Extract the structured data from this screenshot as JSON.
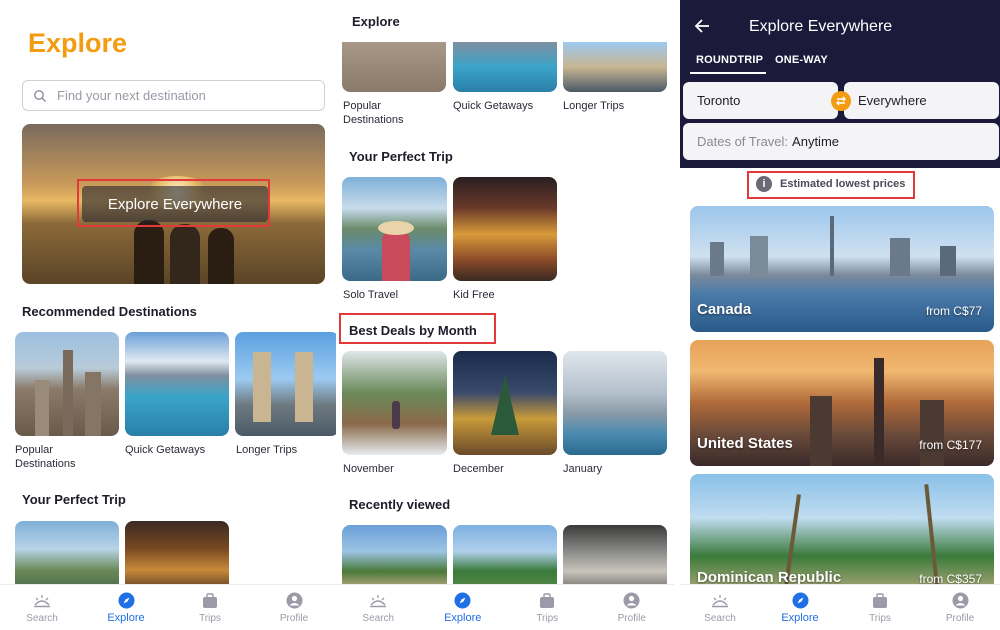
{
  "explore": {
    "title": "Explore",
    "search_placeholder": "Find your next destination",
    "hero_label": "Explore Everywhere",
    "recommended_title": "Recommended Destinations",
    "recommended": [
      {
        "label": "Popular\nDestinations"
      },
      {
        "label": "Quick Getaways"
      },
      {
        "label": "Longer Trips"
      }
    ],
    "perfect_trip_title": "Your Perfect Trip"
  },
  "explore_scrolled": {
    "header": "Explore",
    "top_row": [
      {
        "label": "Popular\nDestinations"
      },
      {
        "label": "Quick Getaways"
      },
      {
        "label": "Longer Trips"
      }
    ],
    "perfect_trip_title": "Your Perfect Trip",
    "perfect_trip": [
      {
        "label": "Solo Travel"
      },
      {
        "label": "Kid Free"
      }
    ],
    "best_deals_title": "Best Deals by Month",
    "months": [
      {
        "label": "November"
      },
      {
        "label": "December"
      },
      {
        "label": "January"
      }
    ],
    "recent_title": "Recently viewed"
  },
  "everywhere": {
    "title": "Explore Everywhere",
    "tabs": [
      "ROUNDTRIP",
      "ONE-WAY"
    ],
    "origin": "Toronto",
    "destination": "Everywhere",
    "dates_label": "Dates of Travel:",
    "dates_value": "Anytime",
    "info_text": "Estimated lowest prices",
    "destinations": [
      {
        "name": "Canada",
        "price": "from C$77"
      },
      {
        "name": "United States",
        "price": "from C$177"
      },
      {
        "name": "Dominican Republic",
        "price": "from C$357"
      }
    ]
  },
  "bottom_nav": [
    "Search",
    "Explore",
    "Trips",
    "Profile"
  ],
  "colors": {
    "accent_orange": "#f39c12",
    "nav_active": "#1f6fe5",
    "header_dark": "#1c1a3a",
    "highlight_red": "#e23a3a"
  }
}
